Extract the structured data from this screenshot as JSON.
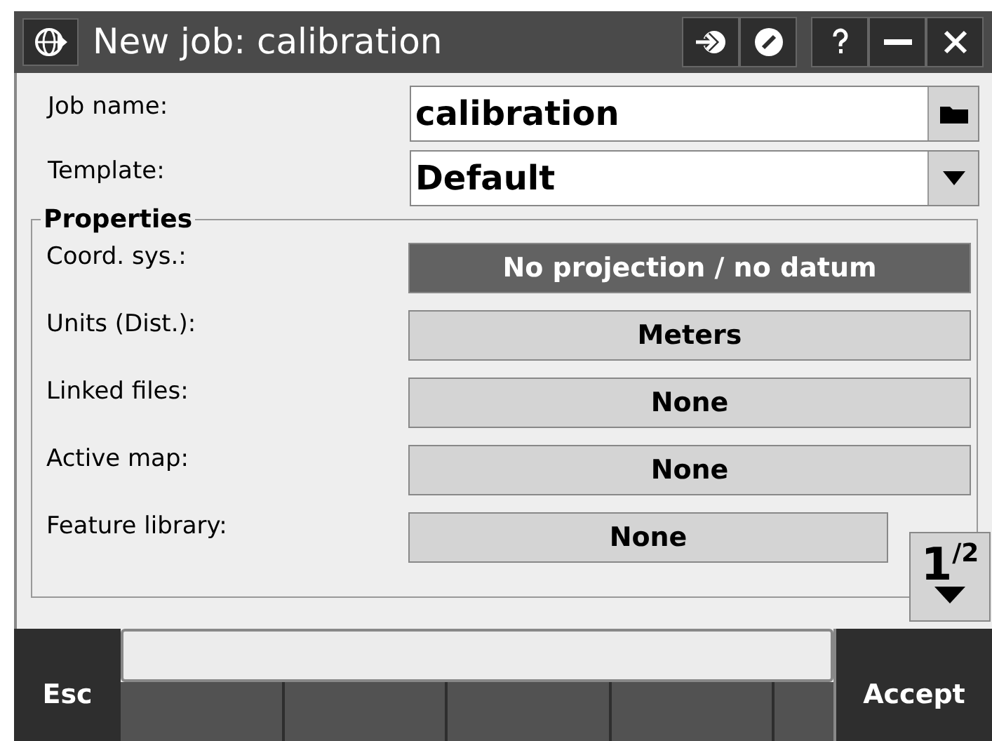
{
  "window": {
    "title": "New job: calibration"
  },
  "fields": [
    {
      "kind": "text",
      "label": "Job name:",
      "value": "calibration"
    },
    {
      "kind": "dropdown",
      "label": "Template:",
      "value": "Default"
    }
  ],
  "properties": {
    "title": "Properties",
    "rows": [
      {
        "label": "Coord. sys.:",
        "value": "No projection / no datum",
        "selected": true
      },
      {
        "label": "Units (Dist.):",
        "value": "Meters",
        "selected": false
      },
      {
        "label": "Linked files:",
        "value": "None",
        "selected": false
      },
      {
        "label": "Active map:",
        "value": "None",
        "selected": false
      },
      {
        "label": "Feature library:",
        "value": "None",
        "selected": false
      }
    ]
  },
  "page": {
    "current": "1",
    "total": "/2"
  },
  "softkeys": {
    "left": "Esc",
    "right": "Accept"
  }
}
